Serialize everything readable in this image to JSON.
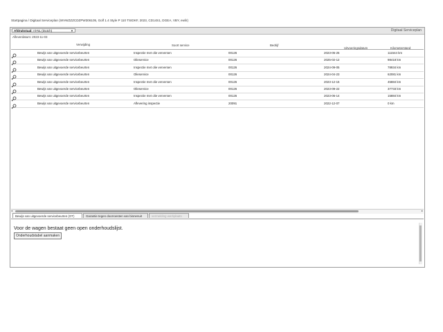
{
  "breadcrumb": "Startpagina / Digitaal Serviceplan (WVWZZZCDZPW306105, Golf 1.4 Style P 110 TSIDKF, 2023, CD14S1, DGEA, VBY, ewlir)",
  "toolbar": {
    "language_label": "Afdrukstaal:",
    "language_value": "nl-NL (Dutch)",
    "app_title": "Digitaal Serviceplan"
  },
  "delivery_date": "Afleverdatum: 2023-11-03",
  "grid": {
    "columns": {
      "reference": "Verwijding",
      "service_type": "Soort service",
      "company": "Bedrijf",
      "execution_date": "Uitvoeringsdatum",
      "odometer": "Kilometerstand"
    },
    "rows": [
      {
        "icon": "search-icon",
        "reference": "Bewijs van uitgevoerde servicebeurten",
        "service_type": "Inspectie met olie verversen",
        "company": "00126",
        "execution_date": "2023-05-25",
        "odometer": "111544 km"
      },
      {
        "icon": "search-icon",
        "reference": "Bewijs van uitgevoerde servicebeurten",
        "service_type": "Olieservice",
        "company": "00126",
        "execution_date": "2025-02-12",
        "odometer": "98418 km"
      },
      {
        "icon": "search-icon",
        "reference": "Bewijs van uitgevoerde servicebeurten",
        "service_type": "Inspectie met olie verversen",
        "company": "00126",
        "execution_date": "2024-09-05",
        "odometer": "78934 km"
      },
      {
        "icon": "search-icon",
        "reference": "Bewijs van uitgevoerde servicebeurten",
        "service_type": "Olieservice",
        "company": "00126",
        "execution_date": "2024-04-23",
        "odometer": "62081 km"
      },
      {
        "icon": "search-icon",
        "reference": "Bewijs van uitgevoerde servicebeurten",
        "service_type": "Inspectie met olie verversen",
        "company": "00126",
        "execution_date": "2023-12-15",
        "odometer": "45884 km"
      },
      {
        "icon": "search-icon",
        "reference": "Bewijs van uitgevoerde servicebeurten",
        "service_type": "Olieservice",
        "company": "00126",
        "execution_date": "2023-09-22",
        "odometer": "37733 km"
      },
      {
        "icon": "search-icon",
        "reference": "Bewijs van uitgevoerde servicebeurten",
        "service_type": "Inspectie met olie verversen",
        "company": "00126",
        "execution_date": "2023-06-14",
        "odometer": "15884 km"
      },
      {
        "icon": "search-icon",
        "reference": "Bewijs van uitgevoerde servicebeurten",
        "service_type": "Aflevering inspectie",
        "company": "20091",
        "execution_date": "2022-12-07",
        "odometer": "0 km"
      }
    ]
  },
  "tabs": [
    {
      "label": "Bewijs van uitgevoerde servicebeurten (OT)",
      "state": "active"
    },
    {
      "label": "Garantie tegen doorroesten van binnenuit",
      "state": "normal"
    },
    {
      "label": "vermelding werkplaats",
      "state": "disabled"
    }
  ],
  "panel": {
    "message": "Voor de wagen bestaat geen open onderhoudslijst.",
    "button_label": "Onderhoudstabel aanmaken"
  }
}
